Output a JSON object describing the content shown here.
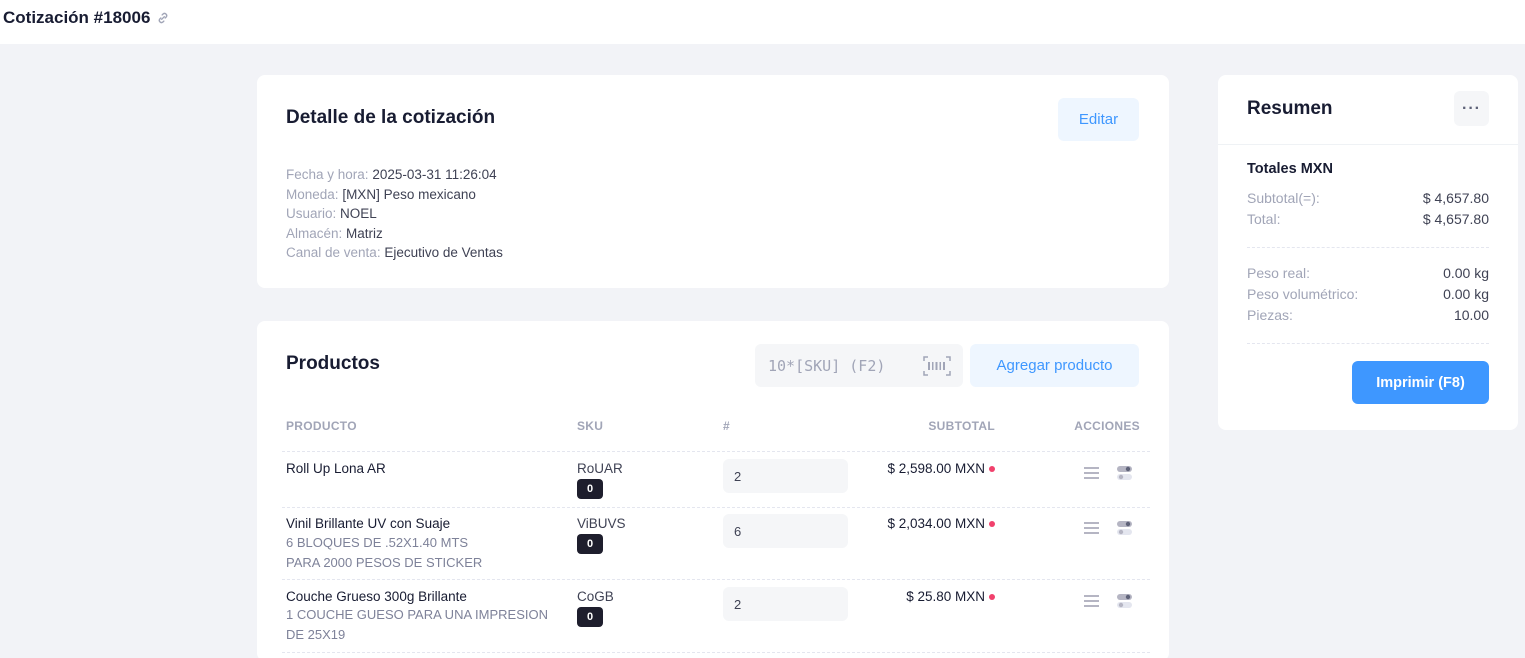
{
  "page": {
    "title": "Cotización #18006",
    "link_icon": "link-icon"
  },
  "detail": {
    "title": "Detalle de la cotización",
    "edit_label": "Editar",
    "fields": [
      {
        "label": "Fecha y hora:",
        "value": "2025-03-31 11:26:04"
      },
      {
        "label": "Moneda:",
        "value": "[MXN] Peso mexicano"
      },
      {
        "label": "Usuario:",
        "value": "NOEL"
      },
      {
        "label": "Almacén:",
        "value": "Matriz"
      },
      {
        "label": "Canal de venta:",
        "value": "Ejecutivo de Ventas"
      }
    ]
  },
  "products": {
    "title": "Productos",
    "sku_input_placeholder": "10*[SKU] (F2)",
    "add_label": "Agregar producto",
    "columns": {
      "product": "PRODUCTO",
      "sku": "SKU",
      "qty": "#",
      "subtotal": "SUBTOTAL",
      "actions": "ACCIONES"
    },
    "rows": [
      {
        "name": "Roll Up Lona AR",
        "note1": "",
        "note2": "",
        "sku": "RoUAR",
        "stock": "0",
        "qty": "2",
        "subtotal": "$ 2,598.00 MXN"
      },
      {
        "name": "Vinil Brillante UV con Suaje",
        "note1": "6 BLOQUES DE .52X1.40 MTS",
        "note2": "PARA 2000 PESOS DE STICKER",
        "sku": "ViBUVS",
        "stock": "0",
        "qty": "6",
        "subtotal": "$ 2,034.00 MXN"
      },
      {
        "name": "Couche Grueso 300g Brillante",
        "note1": "1 COUCHE GUESO PARA UNA IMPRESION",
        "note2": "DE 25X19",
        "sku": "CoGB",
        "stock": "0",
        "qty": "2",
        "subtotal": "$ 25.80 MXN"
      }
    ],
    "status_color": "#f1416c"
  },
  "summary": {
    "title": "Resumen",
    "more_label": "···",
    "subtitle": "Totales MXN",
    "subtotal_label": "Subtotal(=):",
    "subtotal_value": "$ 4,657.80",
    "total_label": "Total:",
    "total_value": "$ 4,657.80",
    "weight_label": "Peso real:",
    "weight_value": "0.00 kg",
    "volweight_label": "Peso volumétrico:",
    "volweight_value": "0.00 kg",
    "pieces_label": "Piezas:",
    "pieces_value": "10.00",
    "print_label": "Imprimir (F8)"
  },
  "colors": {
    "accent": "#3e97ff",
    "accent_light": "#eef6ff",
    "background": "#f2f3f7"
  }
}
